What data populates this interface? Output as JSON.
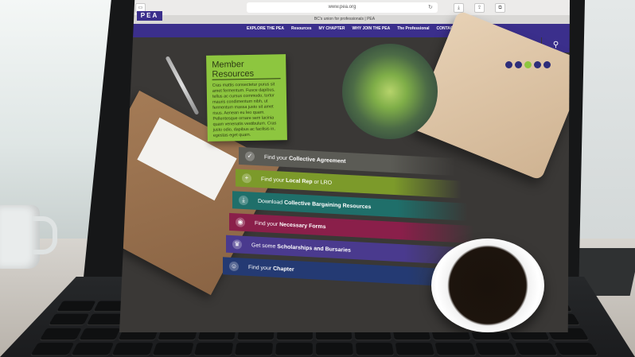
{
  "browser": {
    "url": "www.pea.org",
    "tab_title": "BC's union for professionals | PEA"
  },
  "site": {
    "logo": "PEA",
    "nav": [
      "EXPLORE THE PEA",
      "Resources",
      "MY CHAPTER",
      "WHY JOIN THE PEA",
      "The Professional",
      "CONTACT US"
    ]
  },
  "note": {
    "title": "Member Resources",
    "body": "Cras mattis consectetur purus sit amet fermentum. Fusce dapibus, tellus ac cursus commodo, tortor mauris condimentum nibh, ut fermentum massa justo sit amet risus. Aenean eu leo quam. Pellentesque ornare sem lacinia quam venenatis vestibulum. Cras justo odio, dapibus ac facilisis in, egestas eget quam."
  },
  "menu": [
    {
      "prefix": "Find your ",
      "strong": "Collective Agreement",
      "suffix": "",
      "color": "#5b5b55",
      "icon": "check-icon"
    },
    {
      "prefix": "Find your ",
      "strong": "Local Rep",
      "suffix": " or LRO",
      "color": "#7c9a2a",
      "icon": "search-plus-icon"
    },
    {
      "prefix": "Download ",
      "strong": "Collective Bargaining Resources",
      "suffix": "",
      "color": "#1f6f6a",
      "icon": "download-icon"
    },
    {
      "prefix": "Find your ",
      "strong": "Necessary Forms",
      "suffix": "",
      "color": "#8a1f4a",
      "icon": "target-icon"
    },
    {
      "prefix": "Get some ",
      "strong": "Scholarships and Bursaries",
      "suffix": "",
      "color": "#4a3a8e",
      "icon": "trophy-icon"
    },
    {
      "prefix": "Find your ",
      "strong": "Chapter",
      "suffix": "",
      "color": "#243a73",
      "icon": "people-icon"
    }
  ],
  "dots": [
    "#2d2d7a",
    "#2d2d7a",
    "#8dc63f",
    "#2d2d7a",
    "#2d2d7a"
  ]
}
